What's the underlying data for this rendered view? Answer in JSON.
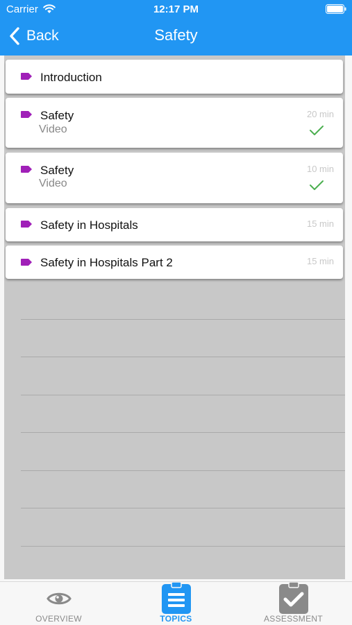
{
  "status_bar": {
    "carrier": "Carrier",
    "time": "12:17 PM"
  },
  "nav": {
    "back_label": "Back",
    "title": "Safety"
  },
  "colors": {
    "header_bg": "#2196f3",
    "tag": "#a020b8",
    "check": "#4caf50",
    "active_tab": "#2196f3",
    "inactive_tab": "#8a8a8a"
  },
  "topics": [
    {
      "title": "Introduction",
      "subtitle": "",
      "duration": "",
      "completed": false,
      "icon": "tag-icon"
    },
    {
      "title": "Safety",
      "subtitle": "Video",
      "duration": "20 min",
      "completed": true,
      "icon": "tag-icon"
    },
    {
      "title": "Safety",
      "subtitle": "Video",
      "duration": "10 min",
      "completed": true,
      "icon": "tag-icon"
    },
    {
      "title": "Safety in Hospitals",
      "subtitle": "",
      "duration": "15 min",
      "completed": false,
      "icon": "tag-icon"
    },
    {
      "title": "Safety in Hospitals Part 2",
      "subtitle": "",
      "duration": "15 min",
      "completed": false,
      "icon": "tag-icon"
    }
  ],
  "tabs": [
    {
      "label": "OVERVIEW",
      "icon": "eye-icon",
      "active": false
    },
    {
      "label": "TOPICS",
      "icon": "clipboard-list-icon",
      "active": true
    },
    {
      "label": "ASSESSMENT",
      "icon": "clipboard-check-icon",
      "active": false
    }
  ]
}
